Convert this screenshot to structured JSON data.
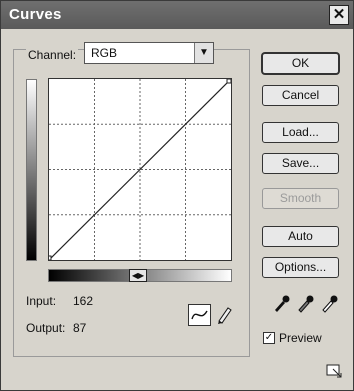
{
  "window": {
    "title": "Curves",
    "close_glyph": "✕"
  },
  "channel": {
    "label": "Channel:",
    "value": "RGB"
  },
  "readout": {
    "input_label": "Input:",
    "input_value": "162",
    "output_label": "Output:",
    "output_value": "87"
  },
  "buttons": {
    "ok": "OK",
    "cancel": "Cancel",
    "load": "Load...",
    "save": "Save...",
    "smooth": "Smooth",
    "auto": "Auto",
    "options": "Options..."
  },
  "preview": {
    "label": "Preview",
    "checked": true
  },
  "curve": {
    "points": [
      [
        0,
        0
      ],
      [
        255,
        255
      ]
    ]
  },
  "icons": {
    "curve_tool": "curve-tool-icon",
    "pencil_tool": "pencil-tool-icon",
    "eyedroppers": [
      "black-eyedropper-icon",
      "gray-eyedropper-icon",
      "white-eyedropper-icon"
    ],
    "resize": "expand-graph-icon"
  }
}
